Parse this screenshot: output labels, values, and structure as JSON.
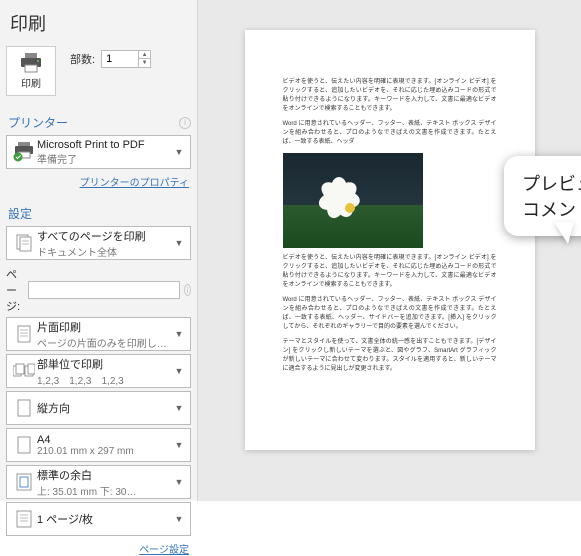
{
  "title": "印刷",
  "top": {
    "print_label": "印刷",
    "copies_label": "部数:",
    "copies_value": "1"
  },
  "printer": {
    "heading": "プリンター",
    "name": "Microsoft Print to PDF",
    "status": "準備完了",
    "properties_link": "プリンターのプロパティ"
  },
  "settings": {
    "heading": "設定",
    "pages": {
      "l1": "すべてのページを印刷",
      "l2": "ドキュメント全体"
    },
    "page_label": "ページ:",
    "page_value": "",
    "sided": {
      "l1": "片面印刷",
      "l2": "ページの片面のみを印刷し…"
    },
    "collate": {
      "l1": "部単位で印刷",
      "l2": "1,2,3　1,2,3　1,2,3"
    },
    "orient": {
      "l1": "縦方向",
      "l2": ""
    },
    "paper": {
      "l1": "A4",
      "l2": "210.01 mm x 297 mm"
    },
    "margin": {
      "l1": "標準の余白",
      "l2": "上: 35.01 mm 下: 30…"
    },
    "ppp": {
      "l1": "1 ページ/枚",
      "l2": ""
    },
    "page_setup_link": "ページ設定"
  },
  "doc": {
    "p1": "ビデオを使うと、伝えたい内容を明確に表現できます。[オンライン ビデオ] をクリックすると、追加したいビデオを、それに応じた埋め込みコードの形式で貼り付けできるようになります。キーワードを入力して、文書に最適なビデオをオンラインで検索することもできます。",
    "p2": "Word に用意されているヘッダー、フッター、表紙、テキスト ボックス デザインを組み合わせると、プロのようなできばえの文書を作成できます。たとえば、一致する表紙、ヘッダ",
    "p3": "ビデオを使うと、伝えたい内容を明確に表現できます。[オンライン ビデオ] をクリックすると、追加したいビデオを、それに応じた埋め込みコードの形式で貼り付けできるようになります。キーワードを入力して、文書に最適なビデオをオンラインで検索することもできます。",
    "p4": "Word に用意されているヘッダー、フッター、表紙、テキスト ボックス デザインを組み合わせると、プロのようなできばえの文書を作成できます。たとえば、一致する表紙、ヘッダー、サイドバーを追加できます。[挿入] をクリックしてから、それぞれのギャラリーで目的の要素を選んでください。",
    "p5": "テーマとスタイルを使って、文書全体の統一感を出すこともできます。[デザイン] をクリックし新しいテーマを選ぶと、図やグラフ、SmartArt グラフィックが新しいテーマに合わせて変わります。スタイルを適用すると、新しいテーマに適合するように見出しが変更されます。"
  },
  "bubble": {
    "line1": "プレビューから",
    "line2": "コメントが消えた"
  }
}
